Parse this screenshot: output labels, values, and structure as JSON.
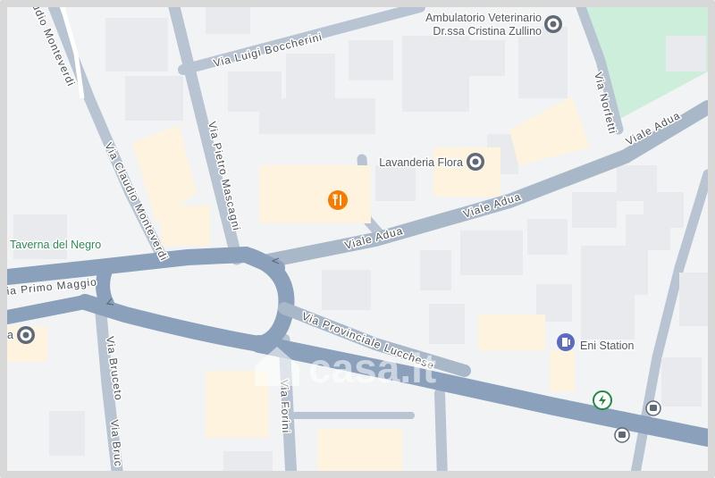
{
  "map": {
    "watermark": "casa.it",
    "colors": {
      "background": "#f1f3f4",
      "building": "#e8eaed",
      "building_yellow": "#fdf3de",
      "road_major": "#8aa0bb",
      "road_minor": "#b8c4d1",
      "park": "#cdeedb",
      "pin": "#5f6a78"
    },
    "streets": [
      {
        "id": "via-luigi-boccherini",
        "name": "Via Luigi Boccherini"
      },
      {
        "id": "via-pietro-mascagni",
        "name": "Via Pietro Mascagni"
      },
      {
        "id": "via-claudio-monteverdi",
        "name": "Via Claudio Monteverdi"
      },
      {
        "id": "via-claudio-monteverdi-top",
        "name": "udio Monteverdi"
      },
      {
        "id": "viale-adua-1",
        "name": "Viale Adua"
      },
      {
        "id": "viale-adua-2",
        "name": "Viale Adua"
      },
      {
        "id": "viale-adua-3",
        "name": "Viale Adua"
      },
      {
        "id": "via-norfetti",
        "name": "Via Norfetti"
      },
      {
        "id": "via-primo-maggio",
        "name": "ia Primo Maggio"
      },
      {
        "id": "via-provinciale-lucchese",
        "name": "Via Provinciale Lucchese"
      },
      {
        "id": "via-bruceto-1",
        "name": "Via Bruceto"
      },
      {
        "id": "via-bruceto-2",
        "name": "Via Bruc"
      },
      {
        "id": "via-forini",
        "name": "Via Forini"
      }
    ],
    "pois": [
      {
        "id": "ambulatorio",
        "line1": "Ambulatorio Veterinario",
        "line2": "Dr.ssa Cristina Zullino",
        "icon": "pin-icon"
      },
      {
        "id": "lavanderia",
        "label": "Lavanderia Flora",
        "icon": "pin-icon"
      },
      {
        "id": "taverna",
        "label": "Taverna del Negro",
        "icon": "none"
      },
      {
        "id": "eni",
        "label": "Eni Station",
        "icon": "fuel-icon"
      },
      {
        "id": "restaurant",
        "label": "",
        "icon": "restaurant-icon"
      },
      {
        "id": "left-pin",
        "label": "a",
        "icon": "pin-icon"
      }
    ],
    "markers": [
      {
        "id": "charging",
        "icon": "ev-charging-icon",
        "color": "#1e8e3e"
      },
      {
        "id": "bus-1",
        "icon": "bus-stop-icon"
      },
      {
        "id": "bus-2",
        "icon": "bus-stop-icon"
      }
    ]
  }
}
